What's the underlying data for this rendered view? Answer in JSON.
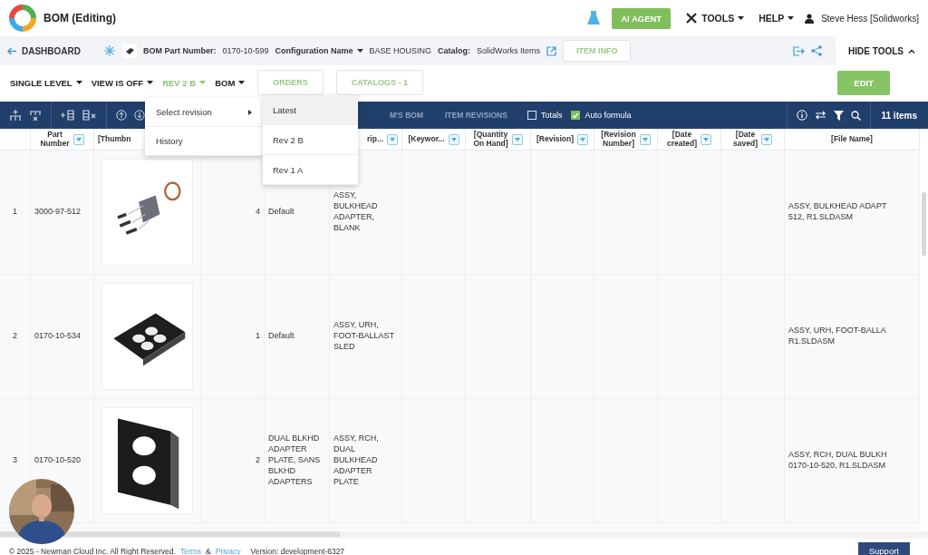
{
  "header": {
    "title": "BOM (Editing)",
    "ai_button": "AI AGENT",
    "menus": [
      "TOOLS",
      "HELP"
    ],
    "user": "Steve Hess [Solidworks]"
  },
  "subbar": {
    "back": "DASHBOARD",
    "part_label": "BOM Part Number:",
    "part_value": "0170-10-599",
    "config_label": "Configuration Name",
    "config_value": "BASE HOUSING",
    "catalog_label": "Catalog:",
    "catalog_value": "SolidWorks Items",
    "info_button": "ITEM INFO",
    "hide_tools": "HIDE TOOLS"
  },
  "toolbar": {
    "dropdowns": [
      {
        "label": "SINGLE LEVEL",
        "expanded": false
      },
      {
        "label": "VIEW IS OFF",
        "expanded": false
      },
      {
        "label": "REV 2 B",
        "expanded": true
      },
      {
        "label": "BOM",
        "expanded": false
      }
    ],
    "buttons": [
      "ORDERS",
      "CATALOGS - 1"
    ],
    "edit_button": "EDIT"
  },
  "table_toolbar": {
    "tabs": [
      "M'S BOM",
      "ITEM REVISIONS"
    ],
    "checkboxes": [
      {
        "label": "Totals",
        "checked": false
      },
      {
        "label": "Auto formula",
        "checked": true
      }
    ],
    "count": "11 items"
  },
  "revision_menu": {
    "items": [
      {
        "label": "Select revision",
        "kind": "submenu"
      },
      {
        "label": "History",
        "kind": "item"
      }
    ],
    "submenu": [
      {
        "label": "Latest",
        "selected": true
      },
      {
        "label": "Rev 2 B",
        "selected": false
      },
      {
        "label": "Rev 1 A",
        "selected": false
      }
    ]
  },
  "table": {
    "columns": [
      {
        "label": "Part Number",
        "filter": true
      },
      {
        "label": "[Thumbn",
        "filter": false
      },
      {
        "label": "rip...",
        "filter": true
      },
      {
        "label": "[Keywor...",
        "filter": true
      },
      {
        "label": "[Quantity On Hand]",
        "filter": true
      },
      {
        "label": "[Revision]",
        "filter": true
      },
      {
        "label": "[Revision Number]",
        "filter": true
      },
      {
        "label": "[Date created]",
        "filter": true
      },
      {
        "label": "[Date saved]",
        "filter": true
      },
      {
        "label": "[File Name]",
        "filter": false
      }
    ],
    "rows": [
      {
        "number": "1",
        "part_number": "3000-97-512",
        "thumbnail": {
          "kind": "picture"
        },
        "quantity": "4",
        "configuration": "Default",
        "description": "ASSY, BULKHEAD ADAPTER, BLANK",
        "file_name": [
          "ASSY, BULKHEAD ADAPT",
          "512, R1.SLDASM"
        ]
      },
      {
        "number": "2",
        "part_number": "0170-10-534",
        "thumbnail": {
          "kind": "picture"
        },
        "quantity": "1",
        "configuration": "Default",
        "description": "ASSY, URH, FOOT-BALLAST SLED",
        "file_name": [
          "ASSY, URH, FOOT-BALLA",
          "R1.SLDASM"
        ]
      },
      {
        "number": "3",
        "part_number": "0170-10-520",
        "thumbnail": {
          "kind": "picture"
        },
        "quantity": "2",
        "configuration": "DUAL BLKHD ADAPTER PLATE, SANS BLKHD ADAPTERS",
        "description": "ASSY, RCH, DUAL BULKHEAD ADAPTER PLATE",
        "file_name": [
          "ASSY, RCH, DUAL BULKH",
          "0170-10-520, R1.SLDASM"
        ]
      }
    ]
  },
  "webcam": {
    "kind": "picture"
  },
  "footer": {
    "copyright": "© 2025 - Newman Cloud Inc. All Right Reserved.",
    "links": [
      "Terms",
      "Privacy"
    ],
    "separator": "&",
    "version": "Version: development-6327",
    "support": "Support"
  }
}
